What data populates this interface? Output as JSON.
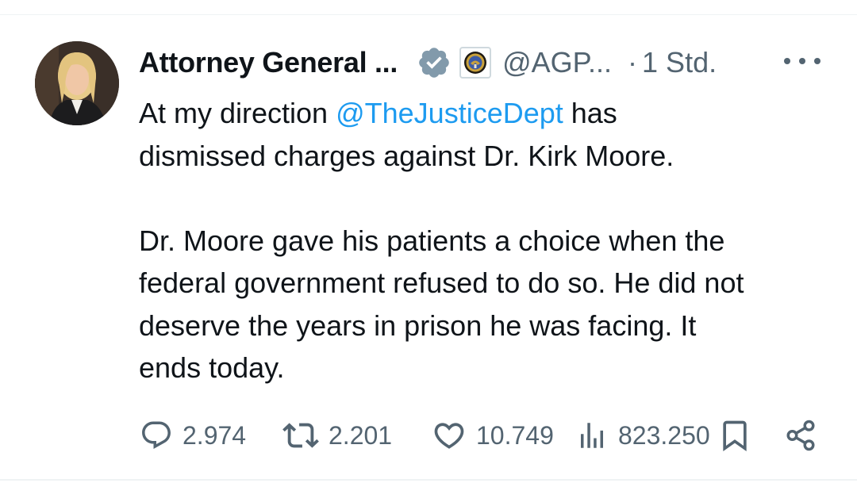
{
  "tweet": {
    "author_name": "Attorney General ...",
    "handle": "@AGP...",
    "separator": "·",
    "time": "1 Std.",
    "text_intro": "At my direction ",
    "mention": "@TheJusticeDept",
    "text_after_mention": " has\ndismissed charges against Dr. Kirk Moore.\n\nDr. Moore gave his patients a choice when the\nfederal government refused to do so. He did not\ndeserve the years in prison he was facing. It\nends today."
  },
  "icons": {
    "verified": "verified-badge-icon",
    "affiliate": "doj-seal-icon",
    "more": "more-icon",
    "reply": "reply-icon",
    "repost": "repost-icon",
    "like": "heart-icon",
    "views": "views-icon",
    "bookmark": "bookmark-icon",
    "share": "share-icon"
  },
  "metrics": {
    "replies": "2.974",
    "reposts": "2.201",
    "likes": "10.749",
    "views": "823.250"
  },
  "colors": {
    "text": "#0f1419",
    "secondary": "#536471",
    "mention": "#1d9bf0",
    "verified_badge": "#829aab"
  }
}
